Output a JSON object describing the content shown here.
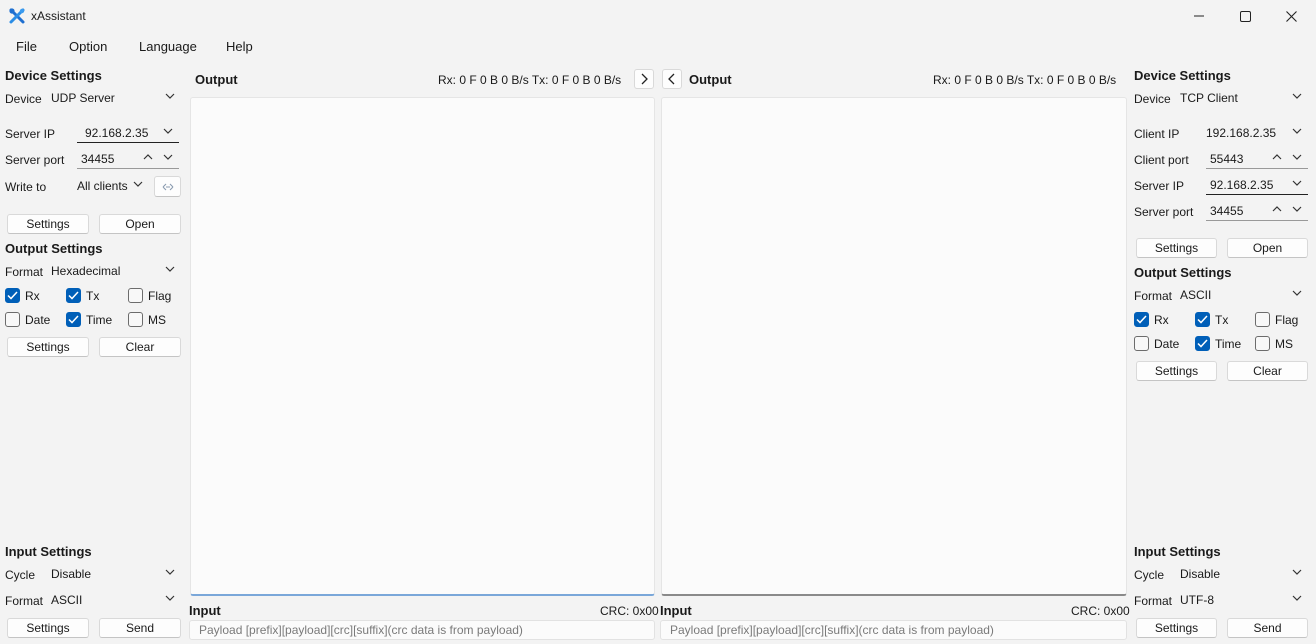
{
  "window": {
    "title": "xAssistant"
  },
  "menu": [
    "File",
    "Option",
    "Language",
    "Help"
  ],
  "left": {
    "device_settings_title": "Device Settings",
    "device_label": "Device",
    "device_value": "UDP Server",
    "server_ip_label": "Server IP",
    "server_ip_value": "92.168.2.35",
    "server_port_label": "Server port",
    "server_port_value": "34455",
    "write_to_label": "Write to",
    "write_to_value": "All clients",
    "settings_btn": "Settings",
    "open_btn": "Open",
    "output_settings_title": "Output Settings",
    "format_label": "Format",
    "format_value": "Hexadecimal",
    "cb_rx": "Rx",
    "cb_tx": "Tx",
    "cb_flag": "Flag",
    "cb_date": "Date",
    "cb_time": "Time",
    "cb_ms": "MS",
    "out_settings_btn": "Settings",
    "clear_btn": "Clear",
    "input_settings_title": "Input Settings",
    "cycle_label": "Cycle",
    "cycle_value": "Disable",
    "in_format_label": "Format",
    "in_format_value": "ASCII",
    "in_settings_btn": "Settings",
    "send_btn": "Send",
    "checks": {
      "rx": true,
      "tx": true,
      "flag": false,
      "date": false,
      "time": true,
      "ms": false
    }
  },
  "center_left": {
    "output_title": "Output",
    "stats": "Rx: 0 F 0 B 0 B/s Tx: 0 F 0 B 0 B/s",
    "input_title": "Input",
    "crc": "CRC: 0x00",
    "payload_placeholder": "Payload [prefix][payload][crc][suffix](crc data is from payload)"
  },
  "center_right": {
    "output_title": "Output",
    "stats": "Rx: 0 F 0 B 0 B/s Tx: 0 F 0 B 0 B/s",
    "input_title": "Input",
    "crc": "CRC: 0x00",
    "payload_placeholder": "Payload [prefix][payload][crc][suffix](crc data is from payload)"
  },
  "right": {
    "device_settings_title": "Device Settings",
    "device_label": "Device",
    "device_value": "TCP Client",
    "client_ip_label": "Client IP",
    "client_ip_value": "192.168.2.35",
    "client_port_label": "Client port",
    "client_port_value": "55443",
    "server_ip_label": "Server IP",
    "server_ip_value": "92.168.2.35",
    "server_port_label": "Server port",
    "server_port_value": "34455",
    "settings_btn": "Settings",
    "open_btn": "Open",
    "output_settings_title": "Output Settings",
    "format_label": "Format",
    "format_value": "ASCII",
    "cb_rx": "Rx",
    "cb_tx": "Tx",
    "cb_flag": "Flag",
    "cb_date": "Date",
    "cb_time": "Time",
    "cb_ms": "MS",
    "out_settings_btn": "Settings",
    "clear_btn": "Clear",
    "input_settings_title": "Input Settings",
    "cycle_label": "Cycle",
    "cycle_value": "Disable",
    "in_format_label": "Format",
    "in_format_value": "UTF-8",
    "in_settings_btn": "Settings",
    "send_btn": "Send",
    "checks": {
      "rx": true,
      "tx": true,
      "flag": false,
      "date": false,
      "time": true,
      "ms": false
    }
  },
  "colors": {
    "accent": "#005fb8",
    "background": "#f3f3f3",
    "output_bg": "#fbfbfb"
  },
  "icons": [
    "app-tools-icon",
    "minimize-icon",
    "maximize-icon",
    "close-icon",
    "chevron-down-icon",
    "chevron-up-icon",
    "chevron-right-icon",
    "chevron-left-icon",
    "checkmark-icon",
    "link-clients-icon"
  ]
}
